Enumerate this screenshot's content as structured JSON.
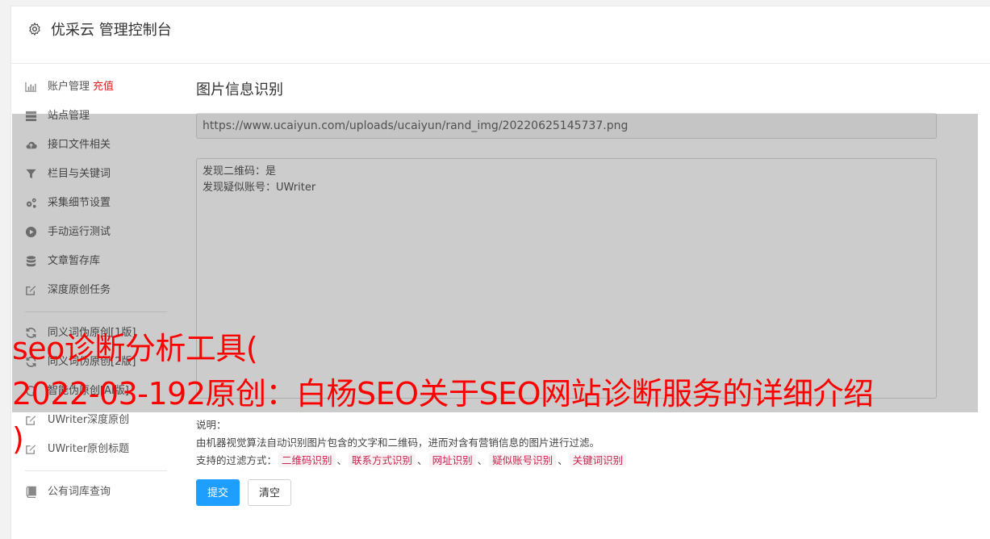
{
  "header": {
    "title": "优采云 管理控制台"
  },
  "sidebar": {
    "group1": [
      {
        "label": "账户管理",
        "hot": "充值",
        "icon": "bar-chart-icon"
      },
      {
        "label": "站点管理",
        "icon": "server-icon"
      },
      {
        "label": "接口文件相关",
        "icon": "cloud-upload-icon"
      },
      {
        "label": "栏目与关键词",
        "icon": "filter-icon"
      },
      {
        "label": "采集细节设置",
        "icon": "cogs-icon"
      },
      {
        "label": "手动运行测试",
        "icon": "play-circle-icon"
      },
      {
        "label": "文章暂存库",
        "icon": "database-icon"
      },
      {
        "label": "深度原创任务",
        "icon": "edit-icon"
      }
    ],
    "group2": [
      {
        "label": "同义词伪原创[1版]",
        "icon": "refresh-icon"
      },
      {
        "label": "同义词伪原创[2版]",
        "icon": "refresh-icon"
      },
      {
        "label": "智能伪原创[AI版]",
        "icon": "refresh-icon"
      },
      {
        "label": "UWriter深度原创",
        "icon": "edit-icon"
      },
      {
        "label": "UWriter原创标题",
        "icon": "edit-icon"
      }
    ],
    "group3": [
      {
        "label": "公有词库查询",
        "icon": "book-icon"
      }
    ]
  },
  "main": {
    "section_title": "图片信息识别",
    "url_value": "https://www.ucaiyun.com/uploads/ucaiyun/rand_img/20220625145737.png",
    "result_lines": [
      "发现二维码：是",
      "发现疑似账号：UWriter"
    ],
    "notes": {
      "label": "说明：",
      "description": "由机器视觉算法自动识别图片包含的文字和二维码，进而对含有营销信息的图片进行过滤。",
      "filter_label": "支持的过滤方式：",
      "filters": [
        "二维码识别",
        "联系方式识别",
        "网址识别",
        "疑似账号识别",
        "关键词识别"
      ],
      "separator": "、"
    },
    "submit_label": "提交",
    "clear_label": "清空"
  },
  "caption": {
    "line1": "seo诊断分析工具(",
    "line2": "2022-03-192原创：白杨SEO关于SEO网站诊断服务的详细介绍",
    "line3": ")"
  },
  "colors": {
    "accent": "#1e9fff",
    "hot": "#e02020",
    "caption": "#ff0000",
    "tag": "#c7254e"
  }
}
